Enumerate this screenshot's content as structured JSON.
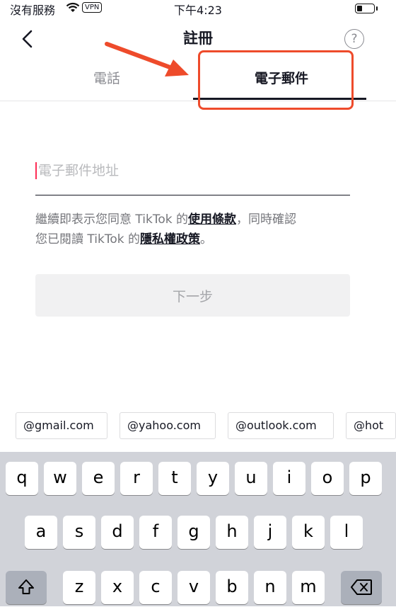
{
  "status_bar": {
    "carrier": "沒有服務",
    "vpn": "VPN",
    "time": "下午4:23"
  },
  "header": {
    "title": "註冊",
    "help": "?"
  },
  "tabs": [
    {
      "label": "電話"
    },
    {
      "label": "電子郵件"
    }
  ],
  "email_input": {
    "placeholder": "電子郵件地址",
    "value": ""
  },
  "terms": {
    "line1_prefix": "繼續即表示您同意 TikTok 的",
    "terms_link": "使用條款",
    "line1_suffix": "，同時確認",
    "line2_prefix": "您已閱讀 TikTok 的",
    "privacy_link": "隱私權政策",
    "line2_suffix": "。"
  },
  "next_button": {
    "label": "下一步"
  },
  "suggestions": [
    "@gmail.com",
    "@yahoo.com",
    "@outlook.com",
    "@hot"
  ],
  "keyboard": {
    "row1": [
      "q",
      "w",
      "e",
      "r",
      "t",
      "y",
      "u",
      "i",
      "o",
      "p"
    ],
    "row2": [
      "a",
      "s",
      "d",
      "f",
      "g",
      "h",
      "j",
      "k",
      "l"
    ],
    "row3": [
      "z",
      "x",
      "c",
      "v",
      "b",
      "n",
      "m"
    ]
  },
  "colors": {
    "annotation": "#ee4b2b",
    "caret": "#fe2c55",
    "keyboard_bg": "#d1d3d9"
  }
}
